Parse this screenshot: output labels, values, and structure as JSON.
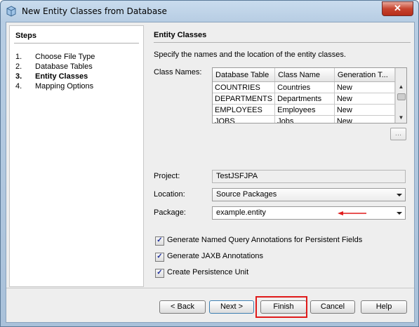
{
  "window": {
    "title": "New Entity Classes from Database",
    "close_glyph": "✕"
  },
  "steps": {
    "title": "Steps",
    "items": [
      {
        "num": "1.",
        "label": "Choose File Type",
        "current": false
      },
      {
        "num": "2.",
        "label": "Database Tables",
        "current": false
      },
      {
        "num": "3.",
        "label": "Entity Classes",
        "current": true
      },
      {
        "num": "4.",
        "label": "Mapping Options",
        "current": false
      }
    ]
  },
  "content": {
    "title": "Entity Classes",
    "description": "Specify the names and the location of the entity classes.",
    "class_names_label": "Class Names:",
    "table": {
      "columns": [
        "Database Table",
        "Class Name",
        "Generation T..."
      ],
      "rows": [
        [
          "COUNTRIES",
          "Countries",
          "New"
        ],
        [
          "DEPARTMENTS",
          "Departments",
          "New"
        ],
        [
          "EMPLOYEES",
          "Employees",
          "New"
        ],
        [
          "JOBS",
          "Jobs",
          "New"
        ]
      ]
    },
    "ellipsis_label": "...",
    "project_label": "Project:",
    "project_value": "TestJSFJPA",
    "location_label": "Location:",
    "location_value": "Source Packages",
    "package_label": "Package:",
    "package_value": "example.entity",
    "checkboxes": [
      {
        "label": "Generate Named Query Annotations for Persistent Fields",
        "checked": true
      },
      {
        "label": "Generate JAXB Annotations",
        "checked": true
      },
      {
        "label": "Create Persistence Unit",
        "checked": true
      }
    ],
    "check_glyph": "✓"
  },
  "buttons": {
    "back": "< Back",
    "next": "Next >",
    "finish": "Finish",
    "cancel": "Cancel",
    "help": "Help"
  },
  "colors": {
    "annotation_red": "#e01b1b",
    "title_bar": "#b7cde3"
  }
}
